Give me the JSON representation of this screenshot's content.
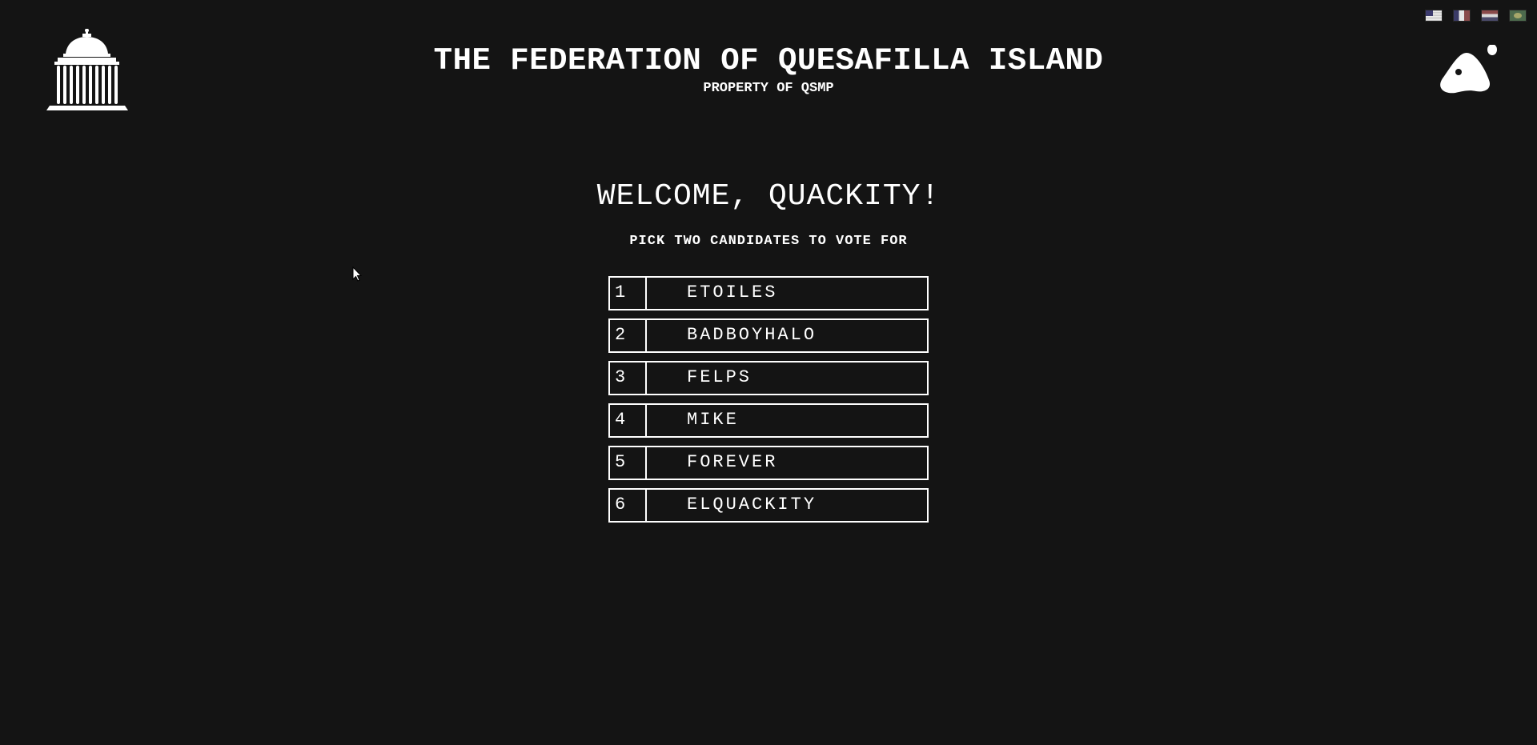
{
  "header": {
    "title": "THE FEDERATION OF QUESAFILLA ISLAND",
    "subtitle": "PROPERTY OF QSMP",
    "left_logo_icon": "capitol-building-icon",
    "right_logo_icon": "qsmp-egg-logo-icon"
  },
  "language_selector": {
    "flags": [
      {
        "icon": "flag-us-icon"
      },
      {
        "icon": "flag-fr-icon"
      },
      {
        "icon": "flag-nl-icon"
      },
      {
        "icon": "flag-br-icon"
      }
    ]
  },
  "main": {
    "welcome": "WELCOME, QUACKITY!",
    "instruction": "PICK TWO CANDIDATES TO VOTE FOR",
    "candidates": [
      {
        "number": "1",
        "name": "ETOILES"
      },
      {
        "number": "2",
        "name": "BADBOYHALO"
      },
      {
        "number": "3",
        "name": "FELPS"
      },
      {
        "number": "4",
        "name": "MIKE"
      },
      {
        "number": "5",
        "name": "FOREVER"
      },
      {
        "number": "6",
        "name": "ELQUACKITY"
      }
    ]
  },
  "colors": {
    "background": "#141414",
    "foreground": "#ffffff"
  }
}
